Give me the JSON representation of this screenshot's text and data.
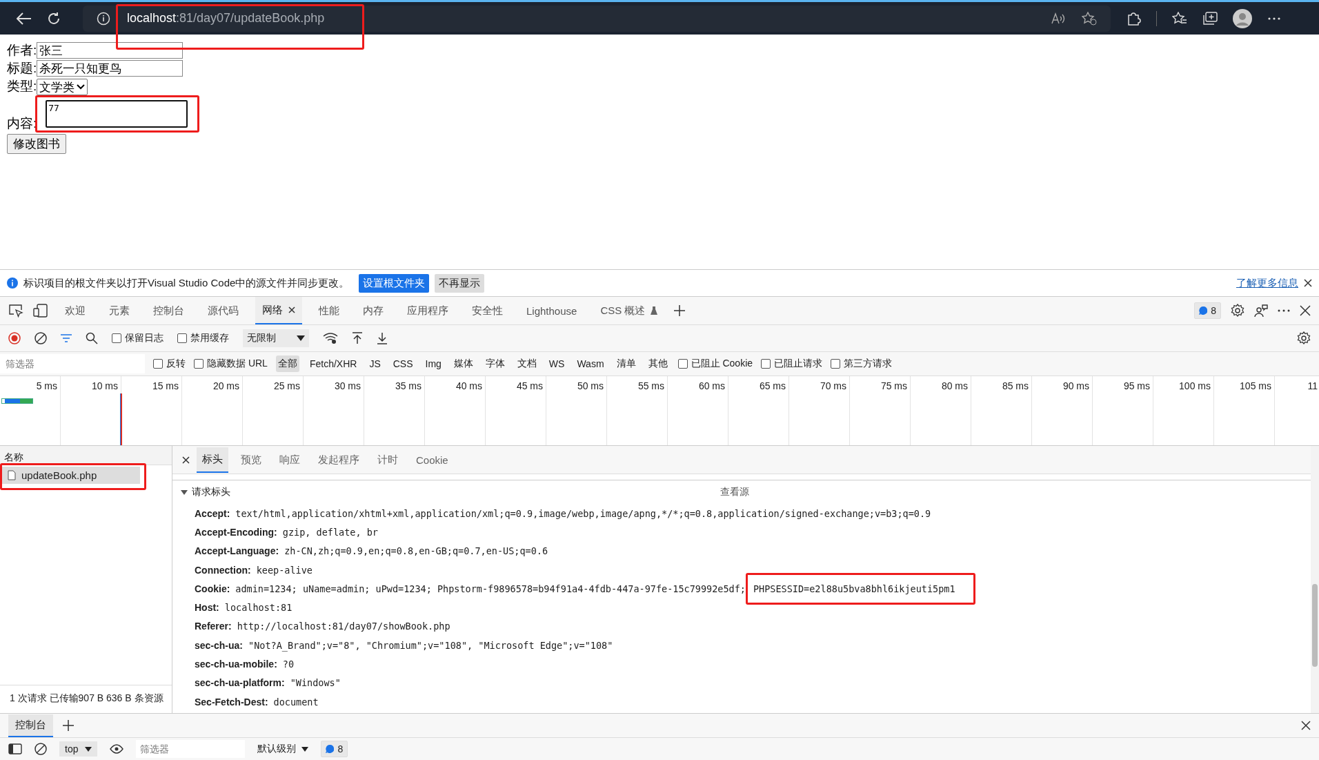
{
  "browser": {
    "url_host": "localhost",
    "url_rest": ":81/day07/updateBook.php"
  },
  "form": {
    "fields": [
      {
        "label": "作者:",
        "kind": "text",
        "value": "张三"
      },
      {
        "label": "标题:",
        "kind": "text",
        "value": "杀死一只知更鸟"
      },
      {
        "label": "类型:",
        "kind": "select",
        "value": "文学类"
      },
      {
        "label": "内容:",
        "kind": "textarea",
        "value": "77"
      }
    ],
    "submit": "修改图书"
  },
  "infobar": {
    "message": "标识项目的根文件夹以打开Visual Studio Code中的源文件并同步更改。",
    "buttons": [
      {
        "label": "设置根文件夹",
        "primary": true
      },
      {
        "label": "不再显示",
        "primary": false
      }
    ],
    "link": "了解更多信息"
  },
  "devtools": {
    "tabs": [
      {
        "label": "欢迎",
        "selected": false
      },
      {
        "label": "元素",
        "selected": false
      },
      {
        "label": "控制台",
        "selected": false
      },
      {
        "label": "源代码",
        "selected": false
      },
      {
        "label": "网络",
        "selected": true
      },
      {
        "label": "性能",
        "selected": false
      },
      {
        "label": "内存",
        "selected": false
      },
      {
        "label": "应用程序",
        "selected": false
      },
      {
        "label": "安全性",
        "selected": false
      },
      {
        "label": "Lighthouse",
        "selected": false
      },
      {
        "label": "CSS 概述",
        "selected": false
      }
    ],
    "issues_count": "8"
  },
  "toolbar": {
    "recording": true,
    "checkboxes": [
      {
        "label": "保留日志",
        "checked": false
      },
      {
        "label": "禁用缓存",
        "checked": false
      }
    ],
    "throttle": "无限制"
  },
  "filter": {
    "placeholder": "筛选器",
    "options": [
      {
        "label": "反转",
        "checked": false
      },
      {
        "label": "隐藏数据 URL",
        "checked": false
      }
    ],
    "types": [
      {
        "label": "全部",
        "selected": true
      },
      {
        "label": "Fetch/XHR",
        "selected": false
      },
      {
        "label": "JS",
        "selected": false
      },
      {
        "label": "CSS",
        "selected": false
      },
      {
        "label": "Img",
        "selected": false
      },
      {
        "label": "媒体",
        "selected": false
      },
      {
        "label": "字体",
        "selected": false
      },
      {
        "label": "文档",
        "selected": false
      },
      {
        "label": "WS",
        "selected": false
      },
      {
        "label": "Wasm",
        "selected": false
      },
      {
        "label": "清单",
        "selected": false
      },
      {
        "label": "其他",
        "selected": false
      }
    ],
    "more_options": [
      {
        "label": "已阻止 Cookie",
        "checked": false
      },
      {
        "label": "已阻止请求",
        "checked": false
      },
      {
        "label": "第三方请求",
        "checked": false
      }
    ]
  },
  "timeline": {
    "ticks": [
      "5 ms",
      "10 ms",
      "15 ms",
      "20 ms",
      "25 ms",
      "30 ms",
      "35 ms",
      "40 ms",
      "45 ms",
      "50 ms",
      "55 ms",
      "60 ms",
      "65 ms",
      "70 ms",
      "75 ms",
      "80 ms",
      "85 ms",
      "90 ms",
      "95 ms",
      "100 ms",
      "105 ms",
      "11"
    ]
  },
  "requests": {
    "header": "名称",
    "items": [
      {
        "name": "updateBook.php",
        "selected": true
      }
    ],
    "summary": "1 次请求  已传输907 B  636 B 条资源"
  },
  "detail": {
    "tabs": [
      {
        "label": "标头",
        "selected": true
      },
      {
        "label": "预览",
        "selected": false
      },
      {
        "label": "响应",
        "selected": false
      },
      {
        "label": "发起程序",
        "selected": false
      },
      {
        "label": "计时",
        "selected": false
      },
      {
        "label": "Cookie",
        "selected": false
      }
    ],
    "section": "请求标头",
    "expanded": true,
    "view_source": "查看源",
    "headers": [
      {
        "name": "Accept:",
        "value": "text/html,application/xhtml+xml,application/xml;q=0.9,image/webp,image/apng,*/*;q=0.8,application/signed-exchange;v=b3;q=0.9"
      },
      {
        "name": "Accept-Encoding:",
        "value": "gzip, deflate, br"
      },
      {
        "name": "Accept-Language:",
        "value": "zh-CN,zh;q=0.9,en;q=0.8,en-GB;q=0.7,en-US;q=0.6"
      },
      {
        "name": "Connection:",
        "value": "keep-alive"
      },
      {
        "name": "Cookie:",
        "value": "admin=1234; uName=admin; uPwd=1234; Phpstorm-f9896578=b94f91a4-4fdb-447a-97fe-15c79992e5df;",
        "highlighted": "PHPSESSID=e2l88u5bva8bhl6ikjeuti5pm1"
      },
      {
        "name": "Host:",
        "value": "localhost:81"
      },
      {
        "name": "Referer:",
        "value": "http://localhost:81/day07/showBook.php"
      },
      {
        "name": "sec-ch-ua:",
        "value": "\"Not?A_Brand\";v=\"8\", \"Chromium\";v=\"108\", \"Microsoft Edge\";v=\"108\""
      },
      {
        "name": "sec-ch-ua-mobile:",
        "value": "?0"
      },
      {
        "name": "sec-ch-ua-platform:",
        "value": "\"Windows\""
      },
      {
        "name": "Sec-Fetch-Dest:",
        "value": "document"
      }
    ]
  },
  "drawer": {
    "tabs": [
      {
        "label": "控制台",
        "selected": true
      }
    ],
    "context": "top",
    "filter_placeholder": "筛选器",
    "level": "默认级别",
    "issues_count": "8"
  }
}
